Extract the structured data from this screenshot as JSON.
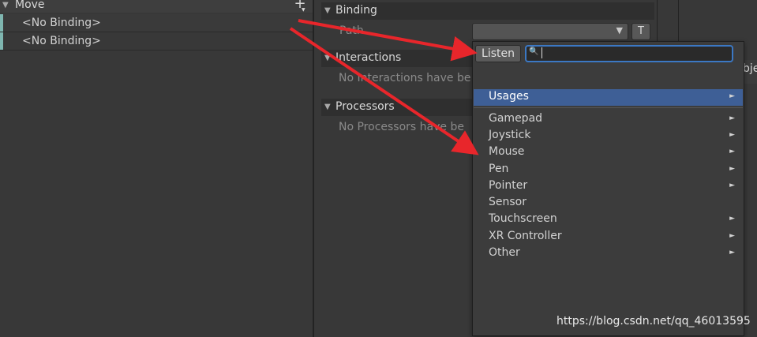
{
  "left_panel": {
    "action_name": "Move",
    "add_button": "+",
    "bindings": [
      {
        "label": "<No Binding>"
      },
      {
        "label": "<No Binding>"
      }
    ]
  },
  "properties": {
    "binding_header": "Binding",
    "path_label": "Path",
    "t_button": "T",
    "interactions_header": "Interactions",
    "no_interactions": "No Interactions have be",
    "processors_header": "Processors",
    "no_processors": "No Processors have be"
  },
  "right_partial": "bje",
  "dropdown": {
    "listen_label": "Listen",
    "search_value": "",
    "items": [
      {
        "label": "Usages",
        "has_submenu": true,
        "selected": true
      },
      {
        "label": "Gamepad",
        "has_submenu": true
      },
      {
        "label": "Joystick",
        "has_submenu": true
      },
      {
        "label": "Mouse",
        "has_submenu": true
      },
      {
        "label": "Pen",
        "has_submenu": true
      },
      {
        "label": "Pointer",
        "has_submenu": true
      },
      {
        "label": "Sensor",
        "has_submenu": false
      },
      {
        "label": "Touchscreen",
        "has_submenu": true
      },
      {
        "label": "XR Controller",
        "has_submenu": true
      },
      {
        "label": "Other",
        "has_submenu": true
      }
    ]
  },
  "watermark": "https://blog.csdn.net/qq_46013595",
  "colors": {
    "selection": "#3e5f96",
    "arrow": "#e8262b",
    "binding_strip": "#7fb6b0",
    "search_focus": "#3b78c4"
  }
}
